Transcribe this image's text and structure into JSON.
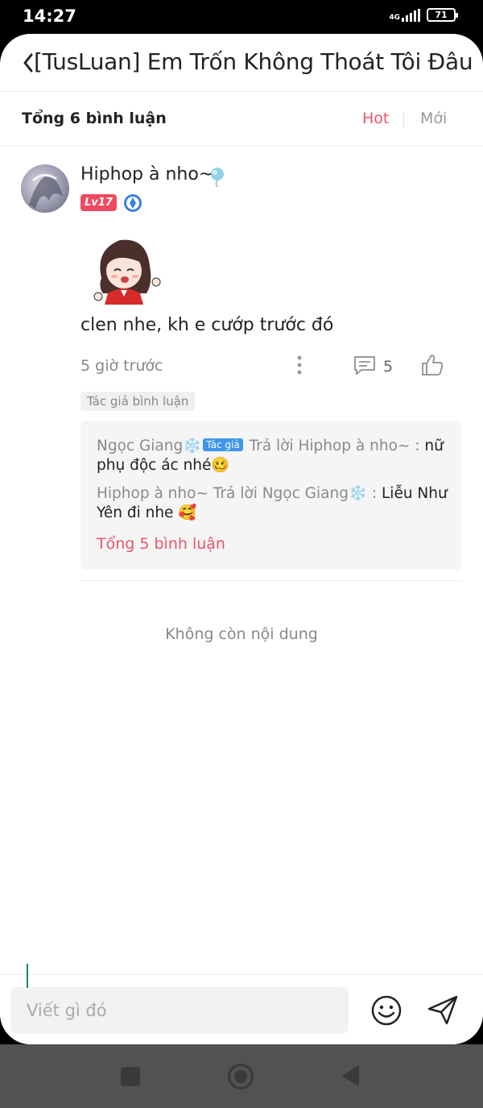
{
  "status_bar": {
    "time": "14:27",
    "network": "4G",
    "battery": "71"
  },
  "header": {
    "title": "[TusLuan] Em Trốn Không Thoát Tôi Đâu"
  },
  "comments_bar": {
    "count_label": "Tổng 6 bình luận",
    "sort_hot": "Hot",
    "sort_new": "Mới"
  },
  "comment": {
    "author": "Hiphop à nho~",
    "level": "Lv17",
    "text": "clen nhe, kh e cướp trước đó",
    "time": "5 giờ trước",
    "reply_count": "5",
    "author_tag": "Tác giả bình luận",
    "replies": [
      {
        "from": "Ngọc Giang❄️",
        "badge": "Tác giả",
        "reply_word": " Trả lời ",
        "to": "Hiphop à nho~",
        "sep": " : ",
        "text": "nữ phụ độc ác nhé🥴"
      },
      {
        "from": "Hiphop à nho~",
        "reply_word": " Trả lời ",
        "to": "Ngọc Giang❄️",
        "sep": " : ",
        "text": "Liễu Như Yên đi nhe 🥰"
      }
    ],
    "replies_total": "Tổng 5 bình luận"
  },
  "end_label": "Không còn nội dung",
  "input": {
    "placeholder": "Viết gì đó"
  },
  "colors": {
    "accent": "#e8556c",
    "level_badge": "#ef4a62",
    "author_badge": "#3d96e8"
  },
  "icons": [
    "back-icon",
    "balloon-icon",
    "vip-icon",
    "more-icon",
    "reply-icon",
    "like-icon",
    "emoji-icon",
    "send-icon"
  ]
}
